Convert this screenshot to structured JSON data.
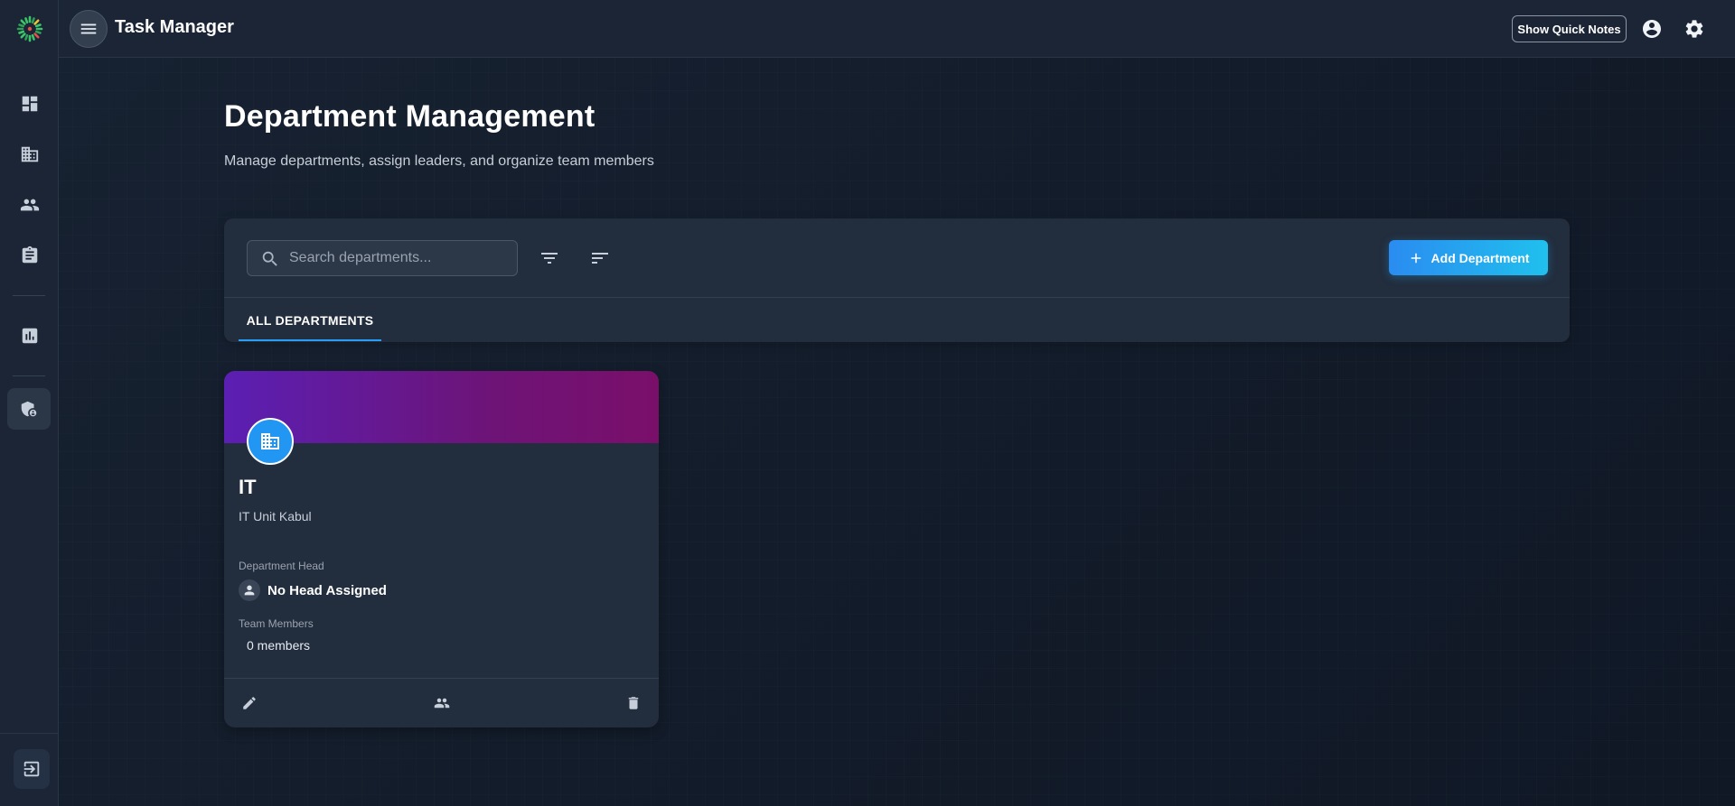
{
  "app": {
    "title": "Task Manager",
    "quick_notes_label": "Show Quick Notes",
    "accent_color": "#2196f3"
  },
  "sidebar": {
    "items": [
      {
        "name": "dashboard",
        "icon": "dashboard-icon"
      },
      {
        "name": "departments",
        "icon": "building-icon"
      },
      {
        "name": "users",
        "icon": "people-icon"
      },
      {
        "name": "tasks",
        "icon": "clipboard-icon"
      },
      {
        "name": "reports",
        "icon": "bar-chart-icon"
      },
      {
        "name": "admin-security",
        "icon": "shield-lock-icon",
        "active": true
      }
    ],
    "logout_icon": "logout-icon"
  },
  "header": {
    "title": "Department Management",
    "subtitle": "Manage departments, assign leaders, and organize team members"
  },
  "toolbar": {
    "search_placeholder": "Search departments...",
    "search_value": "",
    "add_label": "Add Department"
  },
  "tabs": [
    {
      "label": "ALL DEPARTMENTS",
      "active": true
    }
  ],
  "departments": [
    {
      "name": "IT",
      "description": "IT Unit Kabul",
      "head_label": "Department Head",
      "head_value": "No Head Assigned",
      "members_label": "Team Members",
      "members_value": "0 members",
      "banner_colors": [
        "#5b1fb3",
        "#7a0f6a"
      ]
    }
  ]
}
